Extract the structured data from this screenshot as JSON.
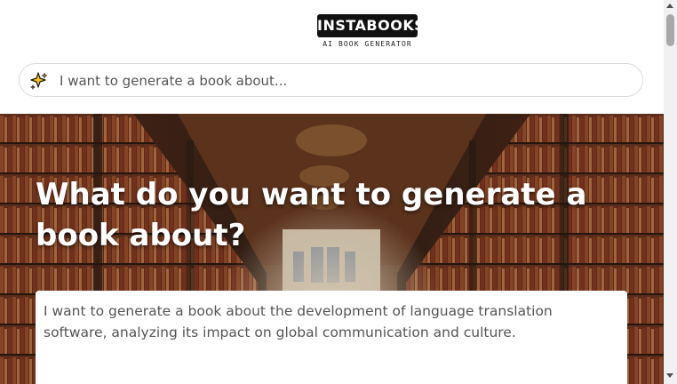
{
  "header": {
    "logo_text": "INSTABOOKS",
    "logo_subtitle": "AI BOOK GENERATOR"
  },
  "search": {
    "icon": "sparkle-icon",
    "placeholder": "I want to generate a book about..."
  },
  "hero": {
    "title": "What do you want to generate a book about?",
    "prompt_value": "I want to generate a book about the development of language translation software, analyzing its impact on global communication and culture.",
    "background": "library-hall-image"
  },
  "colors": {
    "logo_bg": "#111111",
    "hero_text": "#ffffff",
    "input_border": "#d9d9d9"
  }
}
